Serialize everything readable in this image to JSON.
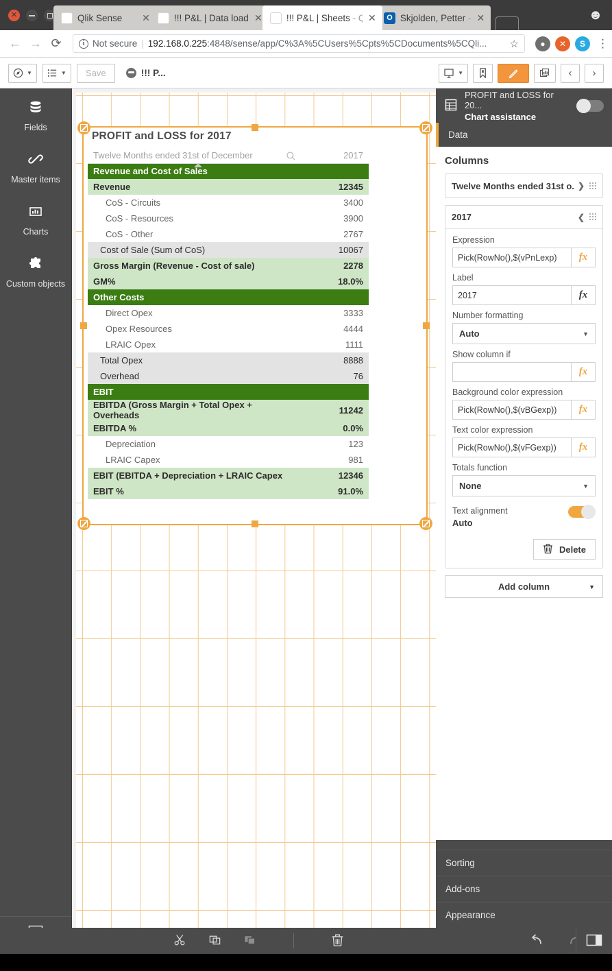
{
  "window": {
    "controls": [
      "close",
      "minimize",
      "maximize"
    ],
    "profile_icon": "user-avatar-icon"
  },
  "browser": {
    "tabs": [
      {
        "title": "Qlik Sense",
        "title_dim": "",
        "favicon": "qlik-favicon",
        "active": false
      },
      {
        "title": "!!! P&L | Data load",
        "title_dim": "",
        "favicon": "qlik-favicon",
        "active": false
      },
      {
        "title": "!!! P&L | Sheets ",
        "title_dim": "- Q",
        "favicon": "qlik-favicon",
        "active": true
      },
      {
        "title": "Skjolden, Petter ",
        "title_dim": "-",
        "favicon": "outlook-favicon",
        "active": false
      }
    ],
    "omnibox": {
      "security_label": "Not secure",
      "url_host": "192.168.0.225",
      "url_path": ":4848/sense/app/C%3A%5CUsers%5Cpts%5CDocuments%5CQli...",
      "star_icon": "star-icon"
    },
    "extensions": [
      "gray-extension-icon",
      "orange-extension-icon",
      "skype-extension-icon"
    ],
    "menu_icon": "three-dot-menu-icon"
  },
  "qlik_toolbar": {
    "navigation_label": "navigation-menu",
    "sheet_list_label": "sheet-list",
    "save_label": "Save",
    "app_name": "!!! P...",
    "right_buttons": [
      {
        "name": "storytelling-button",
        "icon": "presentation-icon"
      },
      {
        "name": "bookmarks-button",
        "icon": "bookmark-icon"
      },
      {
        "name": "edit-sheet-button",
        "icon": "pencil-icon",
        "active": true
      },
      {
        "name": "sheet-view-button",
        "icon": "sheets-icon"
      },
      {
        "name": "previous-sheet-button",
        "icon": "chevron-left-icon"
      },
      {
        "name": "next-sheet-button",
        "icon": "chevron-right-icon"
      }
    ]
  },
  "left_sidebar": {
    "items": [
      {
        "label": "Fields",
        "icon": "database-icon"
      },
      {
        "label": "Master items",
        "icon": "link-icon"
      },
      {
        "label": "Charts",
        "icon": "bar-chart-icon"
      },
      {
        "label": "Custom objects",
        "icon": "puzzle-icon"
      }
    ],
    "bottom_icon": "collapse-panel-icon"
  },
  "chart": {
    "title": "PROFIT and LOSS for 2017",
    "columns": [
      {
        "label": "Twelve Months ended 31st of December",
        "align": "left"
      },
      {
        "label": "2017",
        "align": "right"
      }
    ],
    "search_icon": "search-icon",
    "rows": [
      {
        "label": "Revenue and Cost of Sales",
        "value": "",
        "style": "sect"
      },
      {
        "label": "Revenue",
        "value": "12345",
        "style": "hi"
      },
      {
        "label": "CoS - Circuits",
        "value": "3400",
        "style": "plain"
      },
      {
        "label": "CoS - Resources",
        "value": "3900",
        "style": "plain"
      },
      {
        "label": "CoS - Other",
        "value": "2767",
        "style": "plain"
      },
      {
        "label": "Cost of Sale (Sum of CoS)",
        "value": "10067",
        "style": "sub"
      },
      {
        "label": "Gross Margin (Revenue - Cost of sale)",
        "value": "2278",
        "style": "hi"
      },
      {
        "label": "GM%",
        "value": "18.0%",
        "style": "hi"
      },
      {
        "label": "Other Costs",
        "value": "",
        "style": "sect"
      },
      {
        "label": "Direct Opex",
        "value": "3333",
        "style": "plain"
      },
      {
        "label": "Opex Resources",
        "value": "4444",
        "style": "plain"
      },
      {
        "label": "LRAIC Opex",
        "value": "1111",
        "style": "plain"
      },
      {
        "label": "Total Opex",
        "value": "8888",
        "style": "sub"
      },
      {
        "label": "Overhead",
        "value": "76",
        "style": "sub"
      },
      {
        "label": "EBIT",
        "value": "",
        "style": "sect"
      },
      {
        "label": "EBITDA (Gross Margin + Total Opex + Overheads",
        "value": "11242",
        "style": "hi"
      },
      {
        "label": "EBITDA %",
        "value": "0.0%",
        "style": "hi"
      },
      {
        "label": "Depreciation",
        "value": "123",
        "style": "plain"
      },
      {
        "label": "LRAIC Capex",
        "value": "981",
        "style": "plain"
      },
      {
        "label": "EBIT (EBITDA + Depreciation + LRAIC Capex",
        "value": "12346",
        "style": "hi"
      },
      {
        "label": "EBIT %",
        "value": "91.0%",
        "style": "hi"
      }
    ]
  },
  "chart_data": {
    "type": "table",
    "title": "PROFIT and LOSS for 2017",
    "columns": [
      "Twelve Months ended 31st of December",
      "2017"
    ],
    "rows": [
      [
        "Revenue and Cost of Sales",
        ""
      ],
      [
        "Revenue",
        12345
      ],
      [
        "CoS - Circuits",
        3400
      ],
      [
        "CoS - Resources",
        3900
      ],
      [
        "CoS - Other",
        2767
      ],
      [
        "Cost of Sale (Sum of CoS)",
        10067
      ],
      [
        "Gross Margin (Revenue - Cost of sale)",
        2278
      ],
      [
        "GM%",
        "18.0%"
      ],
      [
        "Other Costs",
        ""
      ],
      [
        "Direct Opex",
        3333
      ],
      [
        "Opex Resources",
        4444
      ],
      [
        "LRAIC Opex",
        1111
      ],
      [
        "Total Opex",
        8888
      ],
      [
        "Overhead",
        76
      ],
      [
        "EBIT",
        ""
      ],
      [
        "EBITDA (Gross Margin + Total Opex + Overheads",
        11242
      ],
      [
        "EBITDA %",
        "0.0%"
      ],
      [
        "Depreciation",
        123
      ],
      [
        "LRAIC Capex",
        981
      ],
      [
        "EBIT (EBITDA + Depreciation + LRAIC Capex",
        12346
      ],
      [
        "EBIT %",
        "91.0%"
      ]
    ]
  },
  "properties": {
    "header": {
      "object_title": "PROFIT and LOSS for 20...",
      "assistance_label": "Chart assistance",
      "assistance_on": false,
      "object_icon": "table-icon"
    },
    "tab_data": "Data",
    "columns_heading": "Columns",
    "dimension_card": {
      "label": "Twelve Months ended 31st o...",
      "chevron": "chevron-right-icon"
    },
    "measure_card": {
      "label": "2017",
      "chevron": "chevron-down-icon",
      "expression_label": "Expression",
      "expression_value": "Pick(RowNo(),$(vPnLexp)",
      "label_label": "Label",
      "label_value": "2017",
      "numberformat_label": "Number formatting",
      "numberformat_value": "Auto",
      "showcolumnif_label": "Show column if",
      "showcolumnif_value": "",
      "bgcolor_label": "Background color expression",
      "bgcolor_value": "Pick(RowNo(),$(vBGexp))",
      "textcolor_label": "Text color expression",
      "textcolor_value": "Pick(RowNo(),$(vFGexp))",
      "totals_label": "Totals function",
      "totals_value": "None",
      "textalign_label": "Text alignment",
      "textalign_value": "Auto",
      "textalign_on": true,
      "delete_label": "Delete",
      "fx_label": "fx"
    },
    "add_column_label": "Add column",
    "sections": [
      "Sorting",
      "Add-ons",
      "Appearance"
    ]
  },
  "bottom_bar": {
    "tools": [
      {
        "name": "cut-button",
        "icon": "scissors-icon"
      },
      {
        "name": "copy-button",
        "icon": "copy-icon"
      },
      {
        "name": "paste-button",
        "icon": "paste-icon"
      },
      {
        "name": "delete-button",
        "icon": "trash-icon"
      }
    ],
    "undo_icon": "undo-icon",
    "redo_icon": "redo-icon",
    "panel_toggle_icon": "panel-toggle-icon"
  },
  "colors": {
    "accent": "#f0a742",
    "section_green": "#3b7d12",
    "highlight_green": "#cfe6c6",
    "subtotal_gray": "#e3e3e3",
    "panel_dark": "#4b4b4b"
  }
}
